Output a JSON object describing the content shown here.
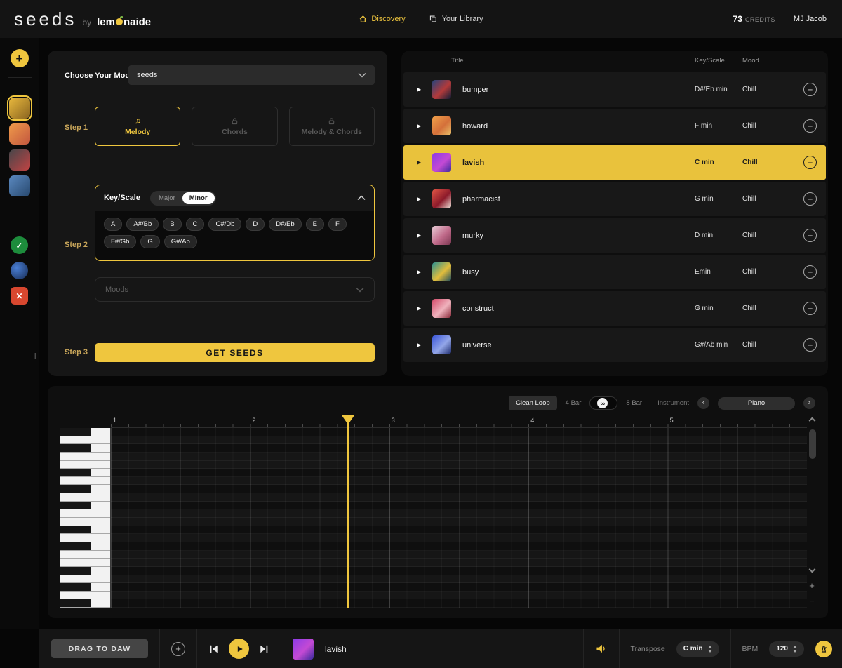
{
  "accent": "#EFC63E",
  "header": {
    "logo_main": "seeds",
    "logo_by": "by",
    "logo_brand_pre": "lem",
    "logo_brand_post": "naide",
    "nav": [
      {
        "label": "Discovery",
        "icon": "home-icon",
        "active": true
      },
      {
        "label": "Your Library",
        "icon": "library-icon",
        "active": false
      }
    ],
    "credits_value": "73",
    "credits_label": "CREDITS",
    "username": "MJ Jacob"
  },
  "sidebar": {
    "collapse_glyph": "‖",
    "icons_top": [
      {
        "name": "seed-avatar",
        "gradient": [
          "#e9b93d",
          "#8a6420"
        ],
        "active": true
      },
      {
        "name": "seed-orange",
        "gradient": [
          "#ef9a4a",
          "#c2563f"
        ],
        "active": false
      },
      {
        "name": "seed-red",
        "gradient": [
          "#46464a",
          "#c24343"
        ],
        "active": false
      },
      {
        "name": "seed-blue",
        "gradient": [
          "#5b89c0",
          "#27486e"
        ],
        "active": false
      }
    ],
    "icons_bottom": [
      {
        "name": "status-success",
        "glyph": "✓",
        "bg": "#1d8c3c",
        "fg": "#ffffff",
        "shape": "circle"
      },
      {
        "name": "status-info",
        "glyph": "",
        "bg": "radial-gradient(circle at 35% 35%, #4a7fd4, #162a52)",
        "fg": "#ffffff",
        "shape": "circle"
      },
      {
        "name": "status-error",
        "glyph": "✕",
        "bg": "#d8472f",
        "fg": "#ffffff",
        "shape": "square"
      }
    ]
  },
  "model_panel": {
    "choose_label": "Choose Your Model",
    "model_value": "seeds",
    "steps": {
      "s1": "Step 1",
      "s2": "Step 2",
      "s3": "Step 3"
    },
    "modes": [
      {
        "label": "Melody",
        "active": true
      },
      {
        "label": "Chords",
        "active": false
      },
      {
        "label": "Melody & Chords",
        "active": false
      }
    ],
    "keyscale": {
      "label": "Key/Scale",
      "major": "Major",
      "minor": "Minor",
      "selected": "Minor",
      "notes": [
        "A",
        "A#/Bb",
        "B",
        "C",
        "C#/Db",
        "D",
        "D#/Eb",
        "E",
        "F",
        "F#/Gb",
        "G",
        "G#/Ab"
      ]
    },
    "moods_placeholder": "Moods",
    "get_seeds_label": "GET SEEDS"
  },
  "library": {
    "columns": {
      "title": "Title",
      "key": "Key/Scale",
      "mood": "Mood"
    },
    "rows": [
      {
        "title": "bumper",
        "key": "D#/Eb min",
        "mood": "Chill",
        "art": [
          "#24437c",
          "#b33a3a",
          "#101d38"
        ],
        "active": false
      },
      {
        "title": "howard",
        "key": "F min",
        "mood": "Chill",
        "art": [
          "#f0a04a",
          "#d4703a",
          "#e8c06a"
        ],
        "active": false
      },
      {
        "title": "lavish",
        "key": "C min",
        "mood": "Chill",
        "art": [
          "#8a3ae8",
          "#c44ad4",
          "#3a2a9c"
        ],
        "active": true
      },
      {
        "title": "pharmacist",
        "key": "G min",
        "mood": "Chill",
        "art": [
          "#e05545",
          "#8c1a2a",
          "#efe3da"
        ],
        "active": false
      },
      {
        "title": "murky",
        "key": "D min",
        "mood": "Chill",
        "art": [
          "#e8ccd6",
          "#c06a8a",
          "#7c3852"
        ],
        "active": false
      },
      {
        "title": "busy",
        "key": "Emin",
        "mood": "Chill",
        "art": [
          "#2c9190",
          "#e2bd3c",
          "#1c4c5e"
        ],
        "active": false
      },
      {
        "title": "construct",
        "key": "G min",
        "mood": "Chill",
        "art": [
          "#d44a6a",
          "#efb3bd",
          "#8c2a3a"
        ],
        "active": false
      },
      {
        "title": "universe",
        "key": "G#/Ab min",
        "mood": "Chill",
        "art": [
          "#3a55d8",
          "#93a6e8",
          "#1c2a6c"
        ],
        "active": false
      }
    ]
  },
  "piano_roll": {
    "clean_loop_label": "Clean Loop",
    "loop_options": {
      "four": "4 Bar",
      "eight": "8 Bar"
    },
    "loop_infinite_glyph": "∞",
    "instrument_label": "Instrument",
    "instrument_value": "Piano",
    "bars": [
      "1",
      "2",
      "3",
      "4",
      "5"
    ],
    "rows": 22,
    "black_key_pattern": [
      1,
      0,
      1,
      0,
      0,
      1,
      0,
      1,
      0,
      1,
      0,
      0
    ],
    "playhead_bar": 2.7
  },
  "transport": {
    "drag_label": "DRAG TO DAW",
    "track_title": "lavish",
    "track_art": [
      "#8a3ae8",
      "#c44ad4",
      "#3a2a9c"
    ],
    "transpose_label": "Transpose",
    "transpose_value": "C min",
    "bpm_label": "BPM",
    "bpm_value": "120"
  }
}
